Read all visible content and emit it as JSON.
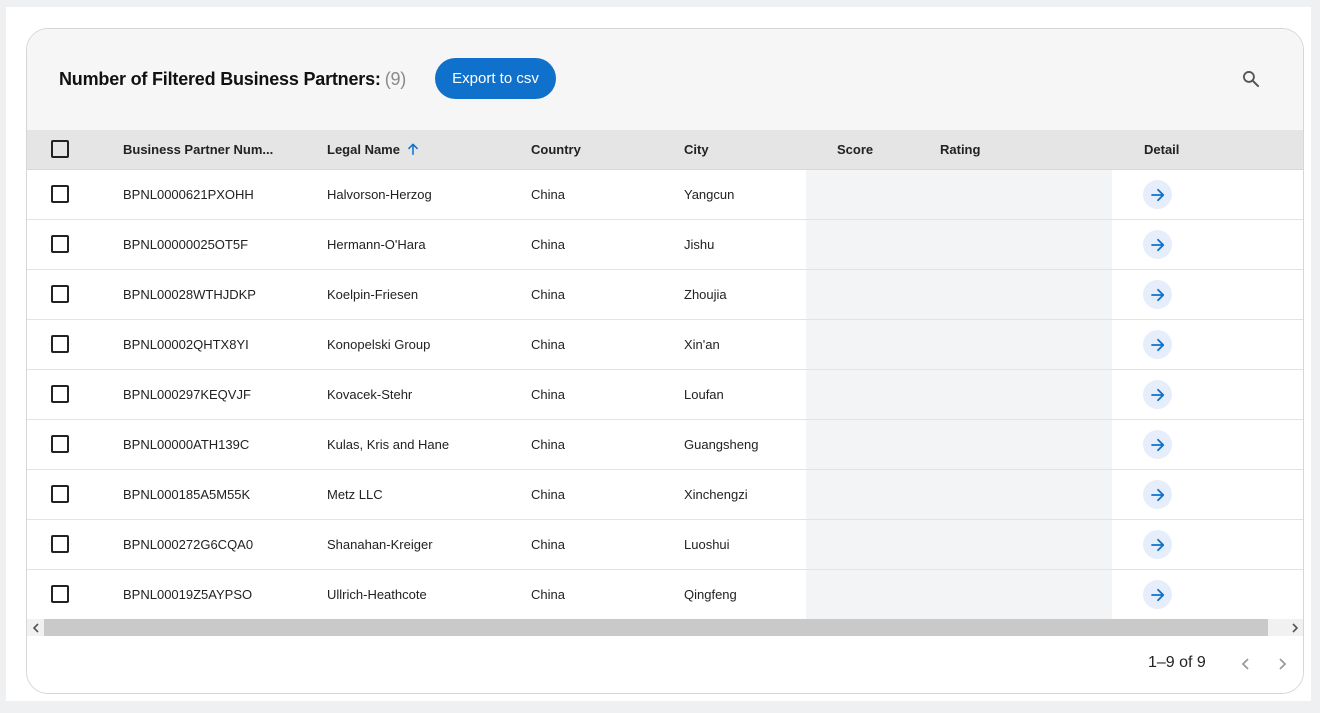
{
  "toolbar": {
    "title": "Number of Filtered Business Partners:",
    "count": "(9)",
    "export_label": "Export to csv",
    "search_icon": "search-icon"
  },
  "table": {
    "columns": [
      {
        "key": "bpn",
        "label": "Business Partner Num..."
      },
      {
        "key": "legal_name",
        "label": "Legal Name",
        "sort": "ascending"
      },
      {
        "key": "country",
        "label": "Country"
      },
      {
        "key": "city",
        "label": "City"
      },
      {
        "key": "score",
        "label": "Score"
      },
      {
        "key": "rating",
        "label": "Rating"
      },
      {
        "key": "detail",
        "label": "Detail"
      }
    ],
    "rows": [
      {
        "bpn": "BPNL0000621PXOHH",
        "legal_name": "Halvorson-Herzog",
        "country": "China",
        "city": "Yangcun"
      },
      {
        "bpn": "BPNL00000025OT5F",
        "legal_name": "Hermann-O'Hara",
        "country": "China",
        "city": "Jishu"
      },
      {
        "bpn": "BPNL00028WTHJDKP",
        "legal_name": "Koelpin-Friesen",
        "country": "China",
        "city": "Zhoujia"
      },
      {
        "bpn": "BPNL00002QHTX8YI",
        "legal_name": "Konopelski Group",
        "country": "China",
        "city": "Xin'an"
      },
      {
        "bpn": "BPNL000297KEQVJF",
        "legal_name": "Kovacek-Stehr",
        "country": "China",
        "city": "Loufan"
      },
      {
        "bpn": "BPNL00000ATH139C",
        "legal_name": "Kulas, Kris and Hane",
        "country": "China",
        "city": "Guangsheng"
      },
      {
        "bpn": "BPNL000185A5M55K",
        "legal_name": "Metz LLC",
        "country": "China",
        "city": "Xinchengzi"
      },
      {
        "bpn": "BPNL000272G6CQA0",
        "legal_name": "Shanahan-Kreiger",
        "country": "China",
        "city": "Luoshui"
      },
      {
        "bpn": "BPNL00019Z5AYPSO",
        "legal_name": "Ullrich-Heathcote",
        "country": "China",
        "city": "Qingfeng"
      }
    ]
  },
  "pagination": {
    "info": "1–9 of 9"
  },
  "colors": {
    "accent": "#0f71cb",
    "detail_bg": "#e6eefb",
    "header_bg": "#e5e5e5"
  }
}
